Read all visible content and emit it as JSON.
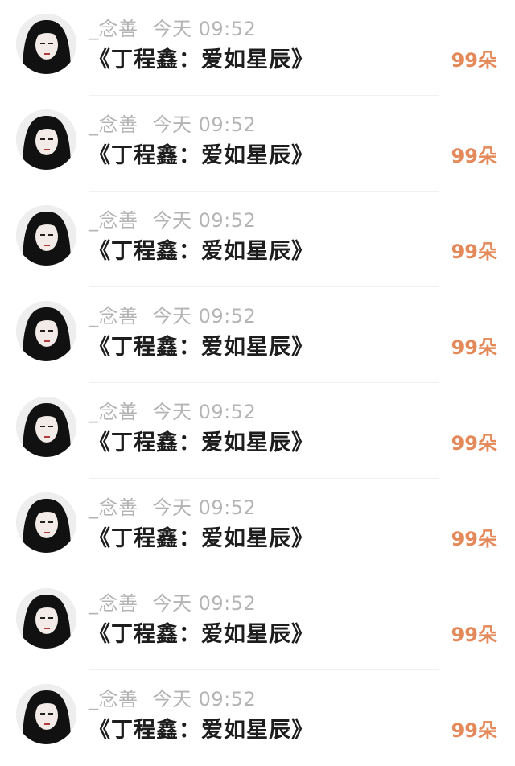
{
  "colors": {
    "gift_accent": "#e4895a",
    "meta_text": "#b4b4b4",
    "title_text": "#1d1d1d"
  },
  "rows": [
    {
      "username": "_念善",
      "time": "今天 09:52",
      "title": "《丁程鑫：爱如星辰》",
      "gift": "99朵",
      "avatar": "user-avatar"
    },
    {
      "username": "_念善",
      "time": "今天 09:52",
      "title": "《丁程鑫：爱如星辰》",
      "gift": "99朵",
      "avatar": "user-avatar"
    },
    {
      "username": "_念善",
      "time": "今天 09:52",
      "title": "《丁程鑫：爱如星辰》",
      "gift": "99朵",
      "avatar": "user-avatar"
    },
    {
      "username": "_念善",
      "time": "今天 09:52",
      "title": "《丁程鑫：爱如星辰》",
      "gift": "99朵",
      "avatar": "user-avatar"
    },
    {
      "username": "_念善",
      "time": "今天 09:52",
      "title": "《丁程鑫：爱如星辰》",
      "gift": "99朵",
      "avatar": "user-avatar"
    },
    {
      "username": "_念善",
      "time": "今天 09:52",
      "title": "《丁程鑫：爱如星辰》",
      "gift": "99朵",
      "avatar": "user-avatar"
    },
    {
      "username": "_念善",
      "time": "今天 09:52",
      "title": "《丁程鑫：爱如星辰》",
      "gift": "99朵",
      "avatar": "user-avatar"
    },
    {
      "username": "_念善",
      "time": "今天 09:52",
      "title": "《丁程鑫：爱如星辰》",
      "gift": "99朵",
      "avatar": "user-avatar"
    }
  ]
}
